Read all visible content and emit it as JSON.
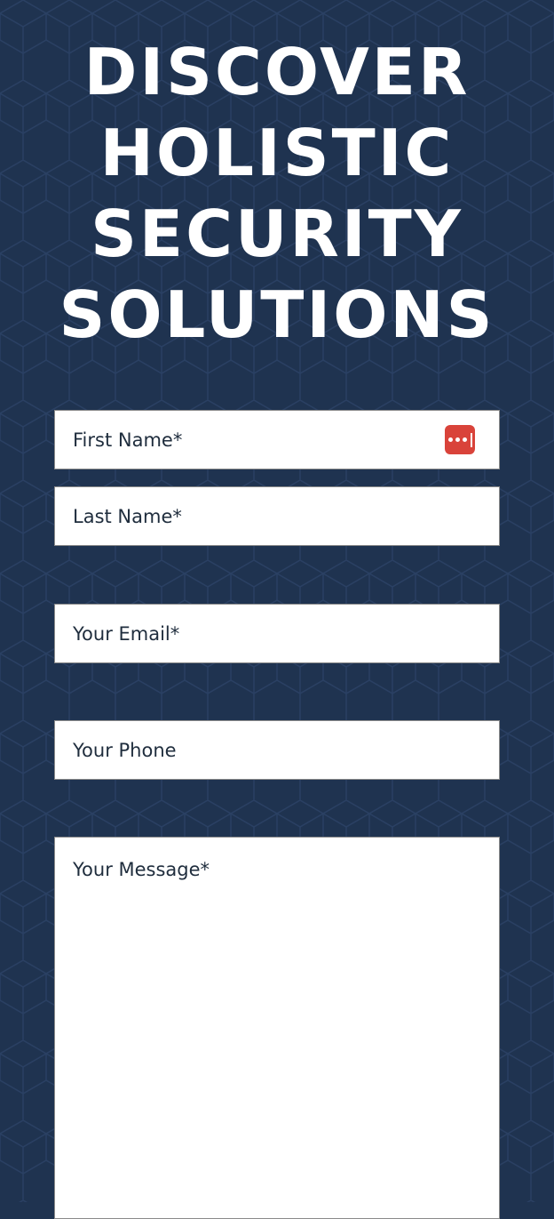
{
  "hero": {
    "title_lines": [
      "DISCOVER",
      "HOLISTIC",
      "SECURITY",
      "SOLUTIONS"
    ]
  },
  "form": {
    "first_name": {
      "placeholder": "First Name*",
      "value": ""
    },
    "last_name": {
      "placeholder": "Last Name*",
      "value": ""
    },
    "email": {
      "placeholder": "Your Email*",
      "value": ""
    },
    "phone": {
      "placeholder": "Your Phone",
      "value": ""
    },
    "message": {
      "placeholder": "Your Message*",
      "value": ""
    }
  },
  "icons": {
    "password_manager": "password-manager-icon"
  },
  "colors": {
    "background": "#1f3350",
    "title_text": "#ffffff",
    "field_background": "#ffffff",
    "field_text": "#1f2d3d",
    "password_manager_icon": "#d9433a"
  }
}
